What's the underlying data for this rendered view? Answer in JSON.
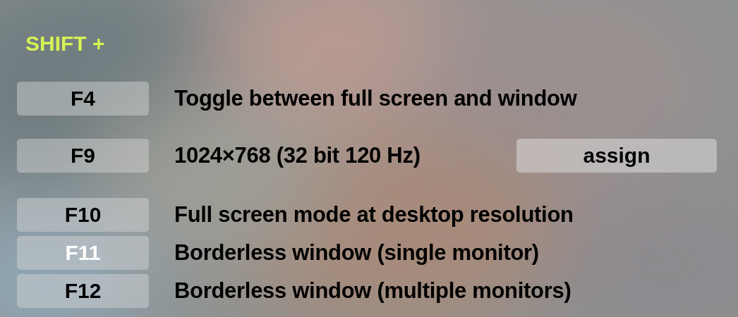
{
  "heading": "SHIFT +",
  "rows": [
    {
      "key": "F4",
      "selected": false,
      "description": "Toggle between full screen and window"
    },
    {
      "key": "F9",
      "selected": false,
      "description": "1024×768 (32 bit 120 Hz)",
      "button": "assign"
    },
    {
      "key": "F10",
      "selected": false,
      "description": "Full screen mode at desktop resolution"
    },
    {
      "key": "F11",
      "selected": true,
      "description": "Borderless window (single monitor)"
    },
    {
      "key": "F12",
      "selected": false,
      "description": "Borderless window (multiple monitors)"
    }
  ]
}
